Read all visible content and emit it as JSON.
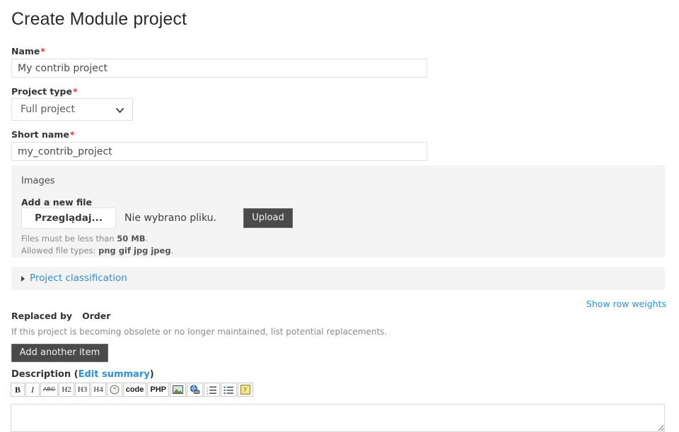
{
  "page": {
    "title": "Create Module project"
  },
  "name_field": {
    "label": "Name",
    "required_mark": "*",
    "value": "My contrib project",
    "placeholder": ""
  },
  "project_type_field": {
    "label": "Project type",
    "required_mark": "*",
    "selected": "Full project",
    "options": [
      "Full project"
    ],
    "icon": "chevron-down-icon"
  },
  "short_name_field": {
    "label": "Short name",
    "required_mark": "*",
    "value": "my_contrib_project",
    "placeholder": ""
  },
  "images_fieldset": {
    "legend": "Images",
    "add_file_label": "Add a new file",
    "browse_button": "Przeglądaj...",
    "no_file_text": "Nie wybrano pliku.",
    "upload_button": "Upload",
    "max_size_prefix": "Files must be less than ",
    "max_size_value": "50 MB",
    "max_size_suffix": ".",
    "allowed_prefix": "Allowed file types: ",
    "allowed_value": "png gif jpg jpeg",
    "allowed_suffix": "."
  },
  "project_classification": {
    "summary": "Project classification",
    "marker_icon": "triangle-right-icon",
    "expanded": false
  },
  "row_weights": {
    "label": "Show row weights"
  },
  "replaced_by": {
    "header_1": "Replaced by",
    "header_2": "Order",
    "description": "If this project is becoming obsolete or no longer maintained, list potential replacements.",
    "add_button": "Add another item"
  },
  "description_section": {
    "label": "Description",
    "open_paren": "(",
    "edit_summary_link": "Edit summary",
    "close_paren": ")",
    "textarea_value": "",
    "textarea_placeholder": ""
  },
  "editor_toolbar": {
    "buttons": [
      {
        "name": "bold-icon",
        "label": "B"
      },
      {
        "name": "italic-icon",
        "label": "I"
      },
      {
        "name": "strikethrough-icon",
        "label": "ABC"
      },
      {
        "name": "heading-2-icon",
        "label": "H2"
      },
      {
        "name": "heading-3-icon",
        "label": "H3"
      },
      {
        "name": "heading-4-icon",
        "label": "H4"
      },
      {
        "name": "blockquote-icon",
        "label": "”"
      },
      {
        "name": "code-icon",
        "label": "code"
      },
      {
        "name": "php-icon",
        "label": "PHP"
      },
      {
        "name": "image-icon",
        "label": ""
      },
      {
        "name": "link-icon",
        "label": ""
      },
      {
        "name": "ordered-list-icon",
        "label": ""
      },
      {
        "name": "unordered-list-icon",
        "label": ""
      },
      {
        "name": "help-icon",
        "label": "?"
      }
    ]
  },
  "colors": {
    "link": "#2d8fd5",
    "required": "#e53935",
    "panel_bg": "#f4f4f4",
    "button_dark": "#4a4a4a",
    "input_border": "#e0e0e0"
  }
}
